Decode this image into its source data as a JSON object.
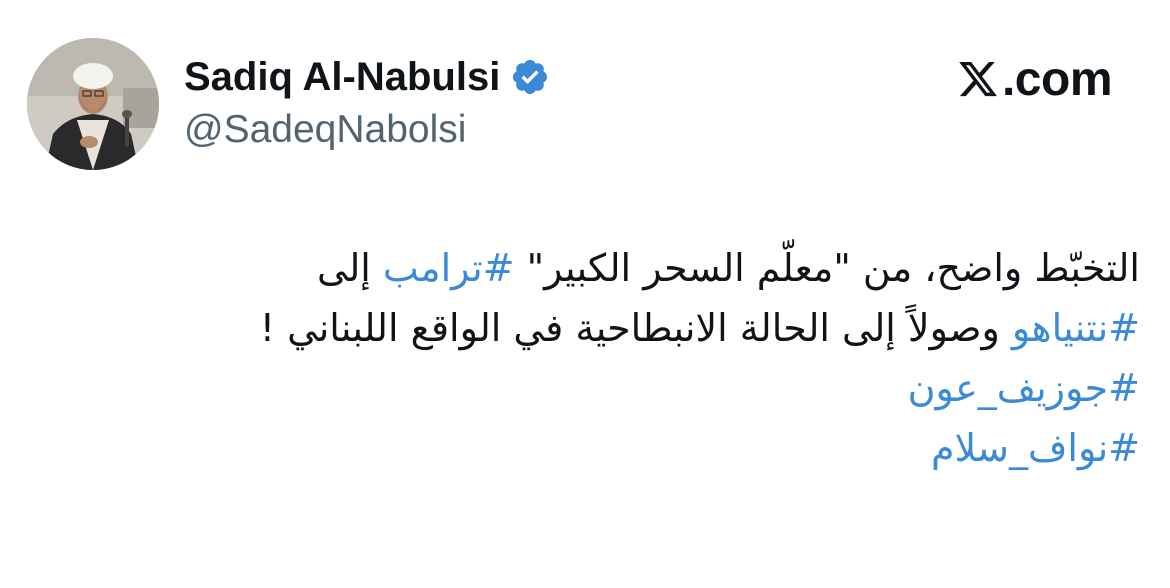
{
  "author": {
    "display_name": "Sadiq Al-Nabulsi",
    "handle": "@SadeqNabolsi",
    "verified_icon": "verified-badge-icon",
    "avatar": "profile-photo"
  },
  "brand": {
    "logo_icon": "x-logo-icon",
    "text": ".com"
  },
  "tweet": {
    "line1": {
      "text_a": "التخبّط  واضح، من \"معلّم السحر الكبير\" ",
      "hashtag": "#ترامب",
      "text_b": " إلى"
    },
    "line2": {
      "hashtag": "#نتنياهو",
      "text": " وصولاً إلى الحالة الانبطاحية في الواقع اللبناني !"
    },
    "hashtag3": "#جوزيف_عون",
    "hashtag4": "#نواف_سلام"
  },
  "colors": {
    "hashtag": "#3b8ad8",
    "verified": "#3b8ad8",
    "handle": "#536471",
    "text": "#0f1419"
  }
}
